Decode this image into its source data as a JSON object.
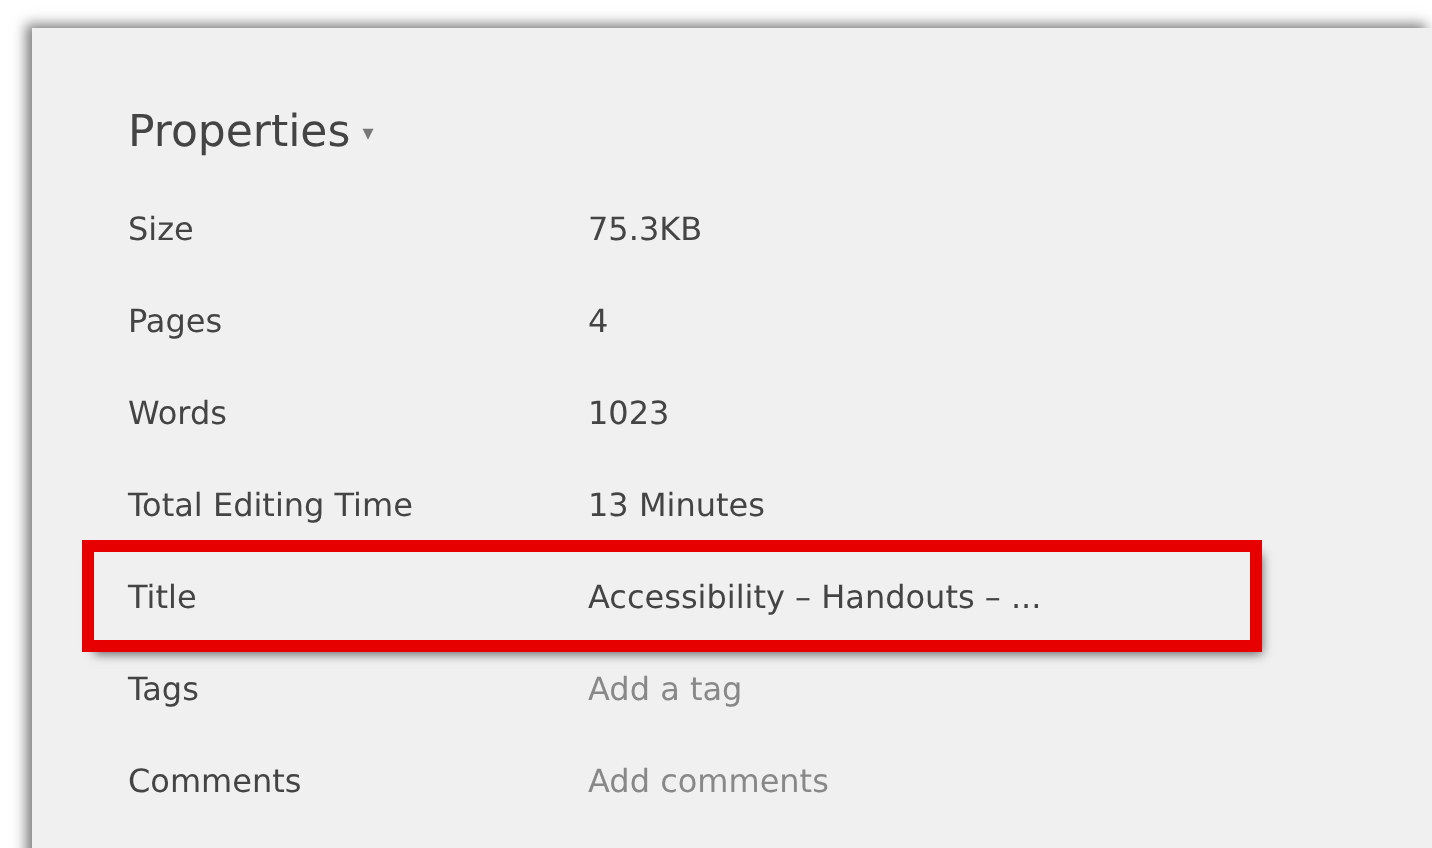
{
  "heading": {
    "label": "Properties",
    "caret": "▾"
  },
  "properties": [
    {
      "label": "Size",
      "value": "75.3KB",
      "highlighted": false
    },
    {
      "label": "Pages",
      "value": "4",
      "highlighted": false
    },
    {
      "label": "Words",
      "value": "1023",
      "highlighted": false
    },
    {
      "label": "Total Editing Time",
      "value": "13 Minutes",
      "highlighted": false
    },
    {
      "label": "Title",
      "value": "Accessibility – Handouts – ...",
      "highlighted": true
    },
    {
      "label": "Tags",
      "placeholder": "Add a tag",
      "highlighted": false
    },
    {
      "label": "Comments",
      "placeholder": "Add comments",
      "highlighted": false
    }
  ]
}
